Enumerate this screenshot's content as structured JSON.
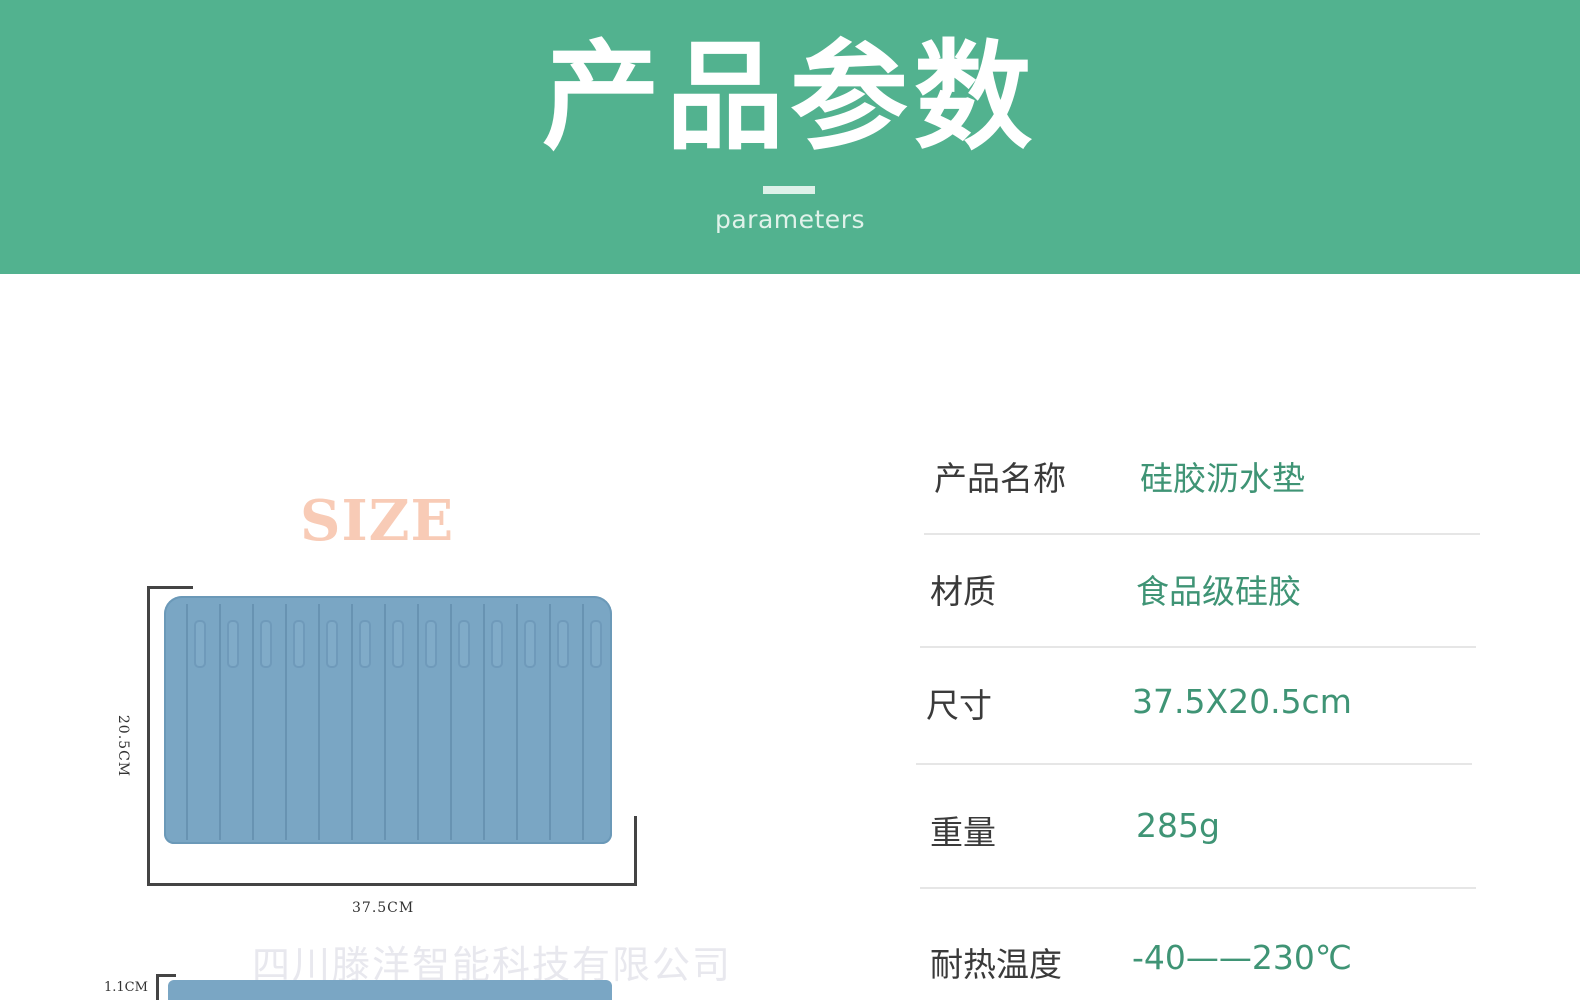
{
  "header": {
    "title": "产品参数",
    "subtitle": "parameters"
  },
  "illustration": {
    "size_label": "SIZE",
    "width_label": "37.5CM",
    "height_label": "20.5CM",
    "watermark": "四川滕洋智能科技有限公司",
    "second_height_label": "1.1CM"
  },
  "params": [
    {
      "label": "产品名称",
      "value": "硅胶沥水垫"
    },
    {
      "label": "材质",
      "value": "食品级硅胶"
    },
    {
      "label": "尺寸",
      "value": "37.5X20.5cm"
    },
    {
      "label": "重量",
      "value": "285g"
    },
    {
      "label": "耐热温度",
      "value": "-40——230℃"
    }
  ],
  "colors": {
    "banner": "#52b28f",
    "value_text": "#3f9475",
    "mat": "#7aa6c4",
    "size_label": "#f8cbb6"
  }
}
